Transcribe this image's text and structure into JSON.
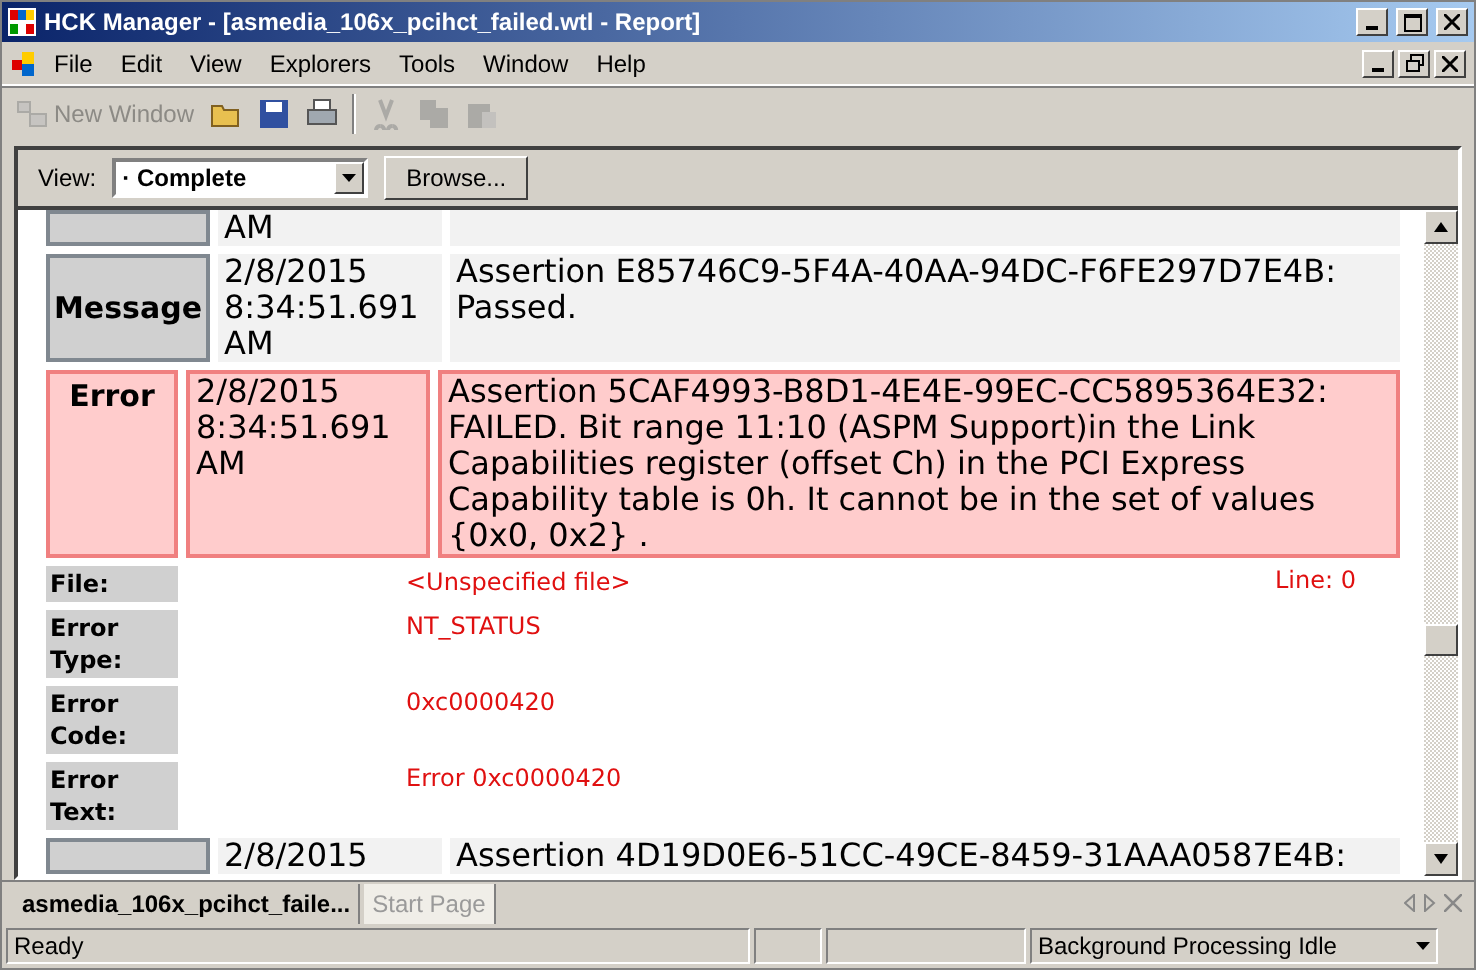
{
  "window": {
    "title": "HCK Manager - [asmedia_106x_pcihct_failed.wtl - Report]"
  },
  "menu": [
    "File",
    "Edit",
    "View",
    "Explorers",
    "Tools",
    "Window",
    "Help"
  ],
  "toolbar": [
    {
      "kind": "new-window",
      "label": "New Window",
      "disabled": true
    },
    {
      "kind": "open",
      "disabled": false
    },
    {
      "kind": "save",
      "disabled": false
    },
    {
      "kind": "print",
      "disabled": false
    },
    {
      "kind": "separator"
    },
    {
      "kind": "cut",
      "disabled": true
    },
    {
      "kind": "copy",
      "disabled": true
    },
    {
      "kind": "paste",
      "disabled": true
    }
  ],
  "view_bar": {
    "label": "View:",
    "value": "· Complete",
    "button": "Browse..."
  },
  "report": [
    {
      "kind": "message",
      "date": "AM"
    },
    {
      "kind": "message",
      "label": "Message",
      "date": "2/8/2015 8:34:51.691 AM",
      "text": "Assertion E85746C9-5F4A-40AA-94DC-F6FE297D7E4B: Passed."
    },
    {
      "kind": "error",
      "label": "Error",
      "date": "2/8/2015 8:34:51.691 AM",
      "text": "Assertion 5CAF4993-B8D1-4E4E-99EC-CC5895364E32: FAILED. Bit range 11:10 (ASPM Support)in the Link Capabilities register (offset Ch) in the PCI Express Capability table is 0h. It cannot be in the set of values {0x0, 0x2} ."
    },
    {
      "kind": "detail",
      "label": "File:",
      "value": "<Unspecified file>",
      "extra": "Line: 0"
    },
    {
      "kind": "detail",
      "label": "Error Type:",
      "value": "NT_STATUS"
    },
    {
      "kind": "detail",
      "label": "Error Code:",
      "value": "0xc0000420"
    },
    {
      "kind": "detail",
      "label": "Error Text:",
      "value": "Error 0xc0000420"
    },
    {
      "kind": "message",
      "date": "2/8/2015",
      "text": "Assertion 4D19D0E6-51CC-49CE-8459-31AAA0587E4B:"
    }
  ],
  "tabs": [
    {
      "label": "asmedia_106x_pcihct_faile...",
      "selected": true
    },
    {
      "label": "Start Page",
      "selected": false
    }
  ],
  "status_bar": {
    "text": "Ready",
    "dropdown": "Background Processing Idle"
  }
}
